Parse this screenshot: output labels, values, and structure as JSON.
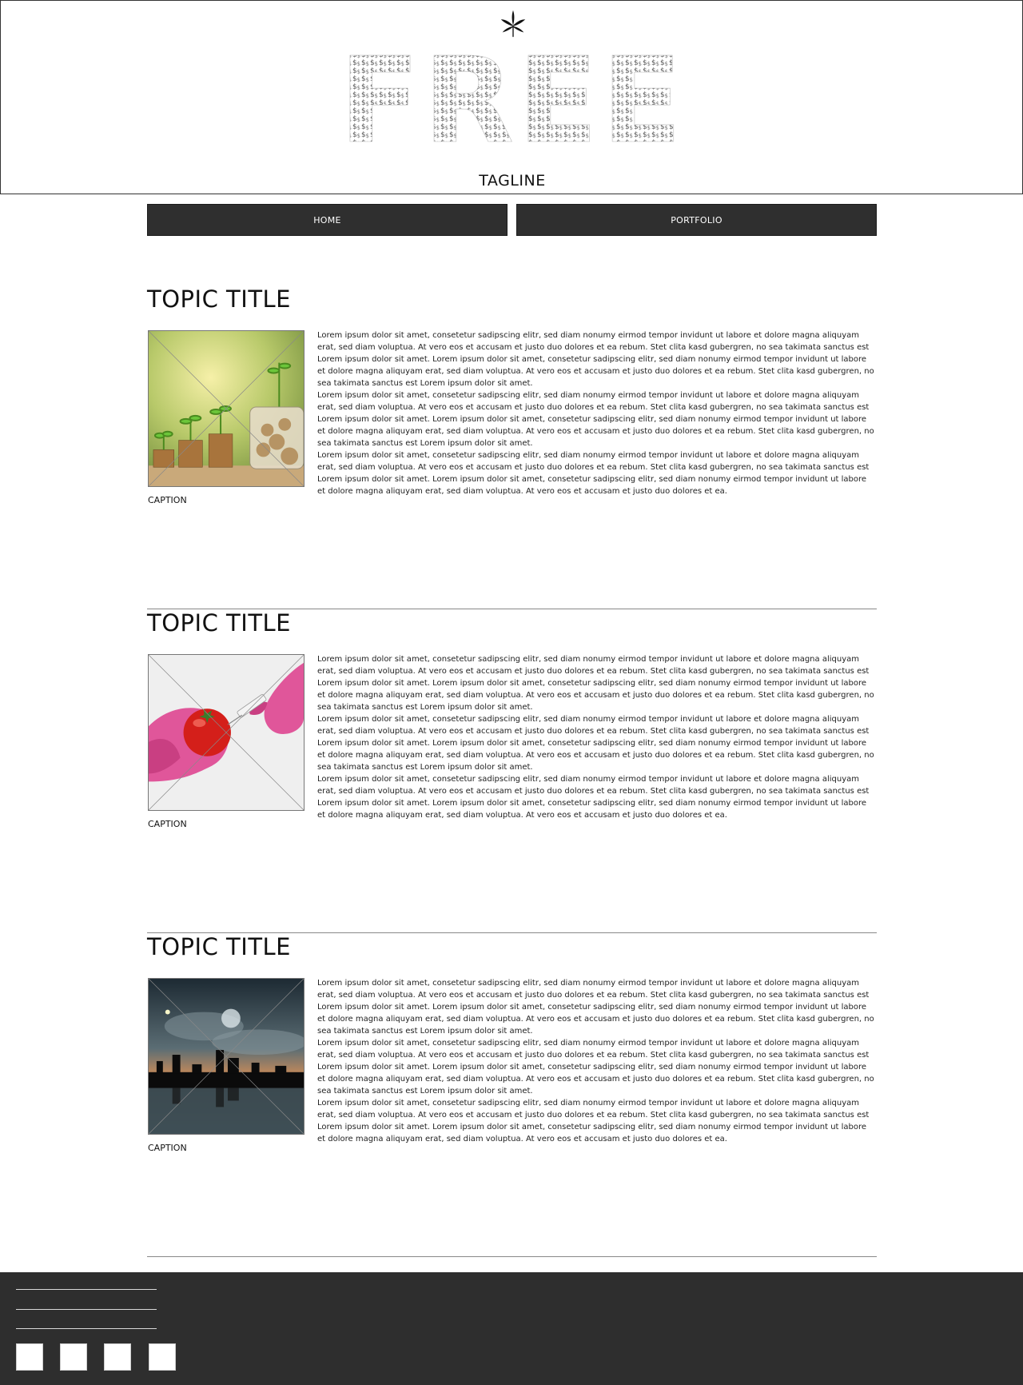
{
  "header": {
    "logo_text": "FREE",
    "tagline": "TAGLINE"
  },
  "nav": {
    "home": "HOME",
    "portfolio": "PORTFOLIO"
  },
  "sections": [
    {
      "title": "TOPIC TITLE",
      "caption": "CAPTION",
      "image": "coins-plants-image",
      "paragraphs": [
        "Lorem ipsum dolor sit amet, consetetur sadipscing elitr, sed diam nonumy eirmod tempor invidunt ut labore et dolore magna aliquyam erat, sed diam voluptua. At vero eos et accusam et justo duo dolores et ea rebum. Stet clita kasd gubergren, no sea takimata sanctus est Lorem ipsum dolor sit amet. Lorem ipsum dolor sit amet, consetetur sadipscing elitr, sed diam nonumy eirmod tempor invidunt ut labore et dolore magna aliquyam erat, sed diam voluptua. At vero eos et accusam et justo duo dolores et ea rebum. Stet clita kasd gubergren, no sea takimata sanctus est Lorem ipsum dolor sit amet.",
        "Lorem ipsum dolor sit amet, consetetur sadipscing elitr, sed diam nonumy eirmod tempor invidunt ut labore et dolore magna aliquyam erat, sed diam voluptua. At vero eos et accusam et justo duo dolores et ea rebum. Stet clita kasd gubergren, no sea takimata sanctus est Lorem ipsum dolor sit amet. Lorem ipsum dolor sit amet, consetetur sadipscing elitr, sed diam nonumy eirmod tempor invidunt ut labore et dolore magna aliquyam erat, sed diam voluptua. At vero eos et accusam et justo duo dolores et ea rebum. Stet clita kasd gubergren, no sea takimata sanctus est Lorem ipsum dolor sit amet.",
        "Lorem ipsum dolor sit amet, consetetur sadipscing elitr, sed diam nonumy eirmod tempor invidunt ut labore et dolore magna aliquyam erat, sed diam voluptua. At vero eos et accusam et justo duo dolores et ea rebum. Stet clita kasd gubergren, no sea takimata sanctus est Lorem ipsum dolor sit amet. Lorem ipsum dolor sit amet, consetetur sadipscing elitr, sed diam nonumy eirmod tempor invidunt ut labore et dolore magna aliquyam erat, sed diam voluptua. At vero eos et accusam et justo duo dolores et ea."
      ]
    },
    {
      "title": "TOPIC TITLE",
      "caption": "CAPTION",
      "image": "tomato-syringe-image",
      "paragraphs": [
        "Lorem ipsum dolor sit amet, consetetur sadipscing elitr, sed diam nonumy eirmod tempor invidunt ut labore et dolore magna aliquyam erat, sed diam voluptua. At vero eos et accusam et justo duo dolores et ea rebum. Stet clita kasd gubergren, no sea takimata sanctus est Lorem ipsum dolor sit amet. Lorem ipsum dolor sit amet, consetetur sadipscing elitr, sed diam nonumy eirmod tempor invidunt ut labore et dolore magna aliquyam erat, sed diam voluptua. At vero eos et accusam et justo duo dolores et ea rebum. Stet clita kasd gubergren, no sea takimata sanctus est Lorem ipsum dolor sit amet.",
        "Lorem ipsum dolor sit amet, consetetur sadipscing elitr, sed diam nonumy eirmod tempor invidunt ut labore et dolore magna aliquyam erat, sed diam voluptua. At vero eos et accusam et justo duo dolores et ea rebum. Stet clita kasd gubergren, no sea takimata sanctus est Lorem ipsum dolor sit amet. Lorem ipsum dolor sit amet, consetetur sadipscing elitr, sed diam nonumy eirmod tempor invidunt ut labore et dolore magna aliquyam erat, sed diam voluptua. At vero eos et accusam et justo duo dolores et ea rebum. Stet clita kasd gubergren, no sea takimata sanctus est Lorem ipsum dolor sit amet.",
        "Lorem ipsum dolor sit amet, consetetur sadipscing elitr, sed diam nonumy eirmod tempor invidunt ut labore et dolore magna aliquyam erat, sed diam voluptua. At vero eos et accusam et justo duo dolores et ea rebum. Stet clita kasd gubergren, no sea takimata sanctus est Lorem ipsum dolor sit amet. Lorem ipsum dolor sit amet, consetetur sadipscing elitr, sed diam nonumy eirmod tempor invidunt ut labore et dolore magna aliquyam erat, sed diam voluptua. At vero eos et accusam et justo duo dolores et ea."
      ]
    },
    {
      "title": "TOPIC TITLE",
      "caption": "CAPTION",
      "image": "night-city-skyline-image",
      "paragraphs": [
        "Lorem ipsum dolor sit amet, consetetur sadipscing elitr, sed diam nonumy eirmod tempor invidunt ut labore et dolore magna aliquyam erat, sed diam voluptua. At vero eos et accusam et justo duo dolores et ea rebum. Stet clita kasd gubergren, no sea takimata sanctus est Lorem ipsum dolor sit amet. Lorem ipsum dolor sit amet, consetetur sadipscing elitr, sed diam nonumy eirmod tempor invidunt ut labore et dolore magna aliquyam erat, sed diam voluptua. At vero eos et accusam et justo duo dolores et ea rebum. Stet clita kasd gubergren, no sea takimata sanctus est Lorem ipsum dolor sit amet.",
        "Lorem ipsum dolor sit amet, consetetur sadipscing elitr, sed diam nonumy eirmod tempor invidunt ut labore et dolore magna aliquyam erat, sed diam voluptua. At vero eos et accusam et justo duo dolores et ea rebum. Stet clita kasd gubergren, no sea takimata sanctus est Lorem ipsum dolor sit amet. Lorem ipsum dolor sit amet, consetetur sadipscing elitr, sed diam nonumy eirmod tempor invidunt ut labore et dolore magna aliquyam erat, sed diam voluptua. At vero eos et accusam et justo duo dolores et ea rebum. Stet clita kasd gubergren, no sea takimata sanctus est Lorem ipsum dolor sit amet.",
        "Lorem ipsum dolor sit amet, consetetur sadipscing elitr, sed diam nonumy eirmod tempor invidunt ut labore et dolore magna aliquyam erat, sed diam voluptua. At vero eos et accusam et justo duo dolores et ea rebum. Stet clita kasd gubergren, no sea takimata sanctus est Lorem ipsum dolor sit amet. Lorem ipsum dolor sit amet, consetetur sadipscing elitr, sed diam nonumy eirmod tempor invidunt ut labore et dolore magna aliquyam erat, sed diam voluptua. At vero eos et accusam et justo duo dolores et ea."
      ]
    }
  ],
  "footer": {
    "social_icons": [
      "social-icon-1",
      "social-icon-2",
      "social-icon-3",
      "social-icon-4"
    ]
  },
  "colors": {
    "nav_bg": "#2f2f2f",
    "footer_bg": "#2e2e2e"
  }
}
